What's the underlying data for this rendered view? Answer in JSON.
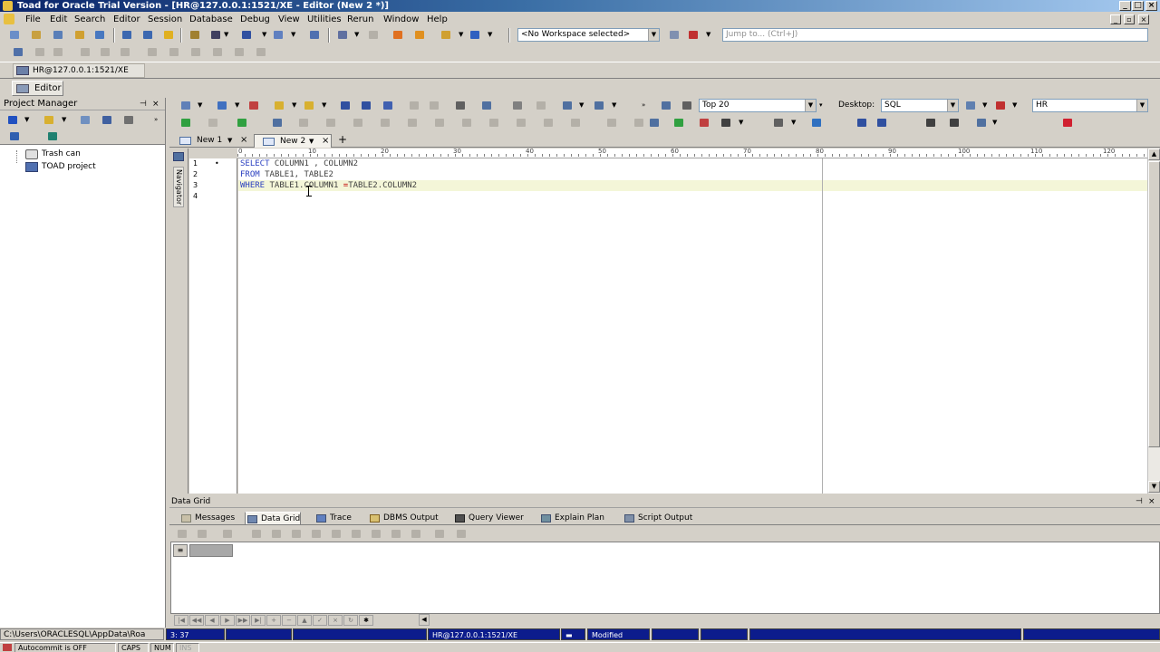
{
  "window": {
    "title": "Toad for Oracle Trial Version - [HR@127.0.0.1:1521/XE - Editor (New 2 *)]"
  },
  "menu": [
    "File",
    "Edit",
    "Search",
    "Editor",
    "Session",
    "Database",
    "Debug",
    "View",
    "Utilities",
    "Rerun",
    "Window",
    "Help"
  ],
  "toolbar": {
    "workspace_value": "<No Workspace selected>",
    "jump_placeholder": "Jump to... (Ctrl+J)"
  },
  "connection_tab": "HR@127.0.0.1:1521/XE",
  "window_bar": {
    "editor_label": "Editor"
  },
  "project_manager": {
    "title": "Project Manager",
    "items": [
      "Trash can",
      "TOAD project"
    ]
  },
  "editor_toolbar": {
    "top_value": "Top 20",
    "desktop_label": "Desktop:",
    "desktop_value": "SQL",
    "schema_value": "HR"
  },
  "editor": {
    "tabs": [
      {
        "label": "New 1",
        "active": false
      },
      {
        "label": "New 2",
        "active": true
      }
    ],
    "add_tab": "+",
    "navigator_label": "Navigator",
    "ruler_ticks": [
      "0",
      "10",
      "20",
      "30",
      "40",
      "50",
      "60",
      "70",
      "80",
      "90",
      "100",
      "110",
      "120"
    ],
    "line_numbers": [
      "1",
      "2",
      "3",
      "4"
    ],
    "code_lines": [
      [
        {
          "t": "SELECT",
          "c": "kw"
        },
        {
          "t": " COLUMN1 , COLUMN2",
          "c": "id"
        }
      ],
      [
        {
          "t": "FROM",
          "c": "kw"
        },
        {
          "t": " TABLE1, TABLE2",
          "c": "id"
        }
      ],
      [
        {
          "t": "WHERE",
          "c": "kw"
        },
        {
          "t": " TABLE1.COLUMN1 ",
          "c": "id"
        },
        {
          "t": "=",
          "c": "op"
        },
        {
          "t": "TABLE2.COLUMN2",
          "c": "id"
        }
      ],
      []
    ],
    "current_line": 3
  },
  "data_grid": {
    "panel_title": "Data Grid",
    "tabs": [
      {
        "label": "Messages",
        "active": false
      },
      {
        "label": "Data Grid",
        "active": true
      },
      {
        "label": "Trace",
        "active": false
      },
      {
        "label": "DBMS Output",
        "active": false
      },
      {
        "label": "Query Viewer",
        "active": false
      },
      {
        "label": "Explain Plan",
        "active": false
      },
      {
        "label": "Script Output",
        "active": false
      }
    ]
  },
  "status": {
    "path": "C:\\Users\\ORACLESQL\\AppData\\Roa",
    "cursor": "3: 37",
    "connection": "HR@127.0.0.1:1521/XE",
    "modified": "Modified",
    "autocommit": "Autocommit is OFF",
    "caps": "CAPS",
    "num": "NUM",
    "ins": "INS"
  },
  "colors": {
    "keyword": "#2a3fc0",
    "current_line_bg": "#f4f6d8",
    "status_bar": "#0c1c8c"
  }
}
